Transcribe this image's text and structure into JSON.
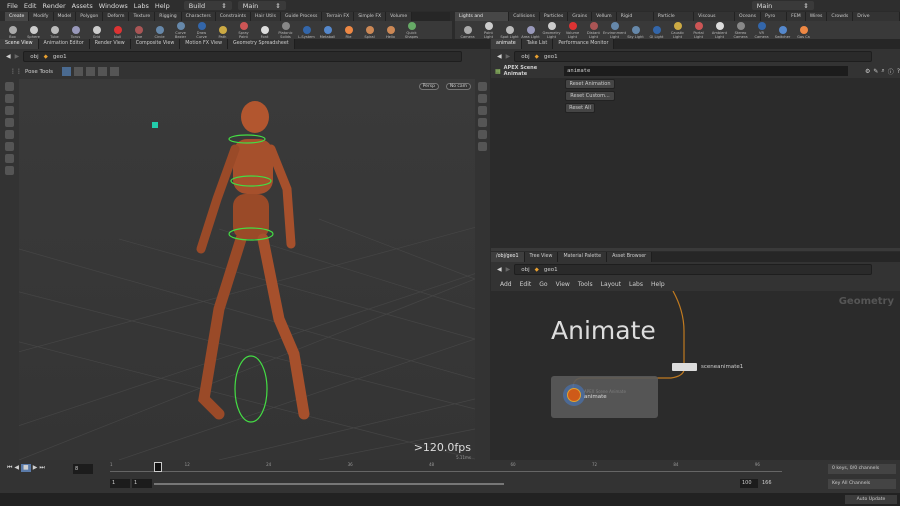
{
  "menu": [
    "File",
    "Edit",
    "Render",
    "Assets",
    "Windows",
    "Labs",
    "Help"
  ],
  "desktop": "Build",
  "desktop2": "Main",
  "desktop3": "Main",
  "shelf_left_tabs": [
    "Create",
    "Modify",
    "Model",
    "Polygon",
    "Deform",
    "Texture",
    "Rigging",
    "Characters",
    "Constraints",
    "Hair Utils",
    "Guide Process",
    "Terrain FX",
    "Simple FX",
    "Volume"
  ],
  "shelf_left_tools": [
    "Box",
    "Sphere",
    "Tube",
    "Torus",
    "Grid",
    "Null",
    "Line",
    "Circle",
    "Curve Bezier",
    "Draw Curve",
    "Path",
    "Spray Paint",
    "Font",
    "Platonic Solids",
    "L-System",
    "Metaball",
    "File",
    "Spiral",
    "Helix",
    "Quick Shapes"
  ],
  "shelf_right_tabs": [
    "Lights and Cameras",
    "Collisions",
    "Particles",
    "Grains",
    "Vellum",
    "Rigid Bodies",
    "Particle Fluids",
    "Viscous Fluids",
    "Oceans",
    "Pyro FX",
    "FEM",
    "Wires",
    "Crowds",
    "Drive Simulation"
  ],
  "shelf_right_tools": [
    "Camera",
    "Point Light",
    "Spot Light",
    "Area Light",
    "Geometry Light",
    "Volume Light",
    "Distant Light",
    "Environment Light",
    "Sky Light",
    "GI Light",
    "Caustic Light",
    "Portal Light",
    "Ambient Light",
    "Stereo Camera",
    "VR Camera",
    "Switcher",
    "Gas Ca"
  ],
  "left_pane": {
    "tabs": [
      "Scene View",
      "Animation Editor",
      "Render View",
      "Composite View",
      "Motion FX View",
      "Geometry Spreadsheet"
    ],
    "path": [
      "obj",
      "geo1"
    ],
    "pose_tools": "Pose Tools",
    "persp": "Persp",
    "cam": "No cam",
    "fps": ">120.0fps",
    "ms": "5.11ms"
  },
  "param_pane": {
    "tabs": [
      "animate",
      "Take List",
      "Performance Monitor"
    ],
    "path": [
      "obj",
      "geo1"
    ],
    "node_type": "APEX Scene Animate",
    "node_name": "animate",
    "buttons": [
      "Reset Animation",
      "Reset Custom...",
      "Reset All"
    ]
  },
  "network_pane": {
    "tabs": [
      "/obj/geo1",
      "Tree View",
      "Material Palette",
      "Asset Browser"
    ],
    "path": [
      "obj",
      "geo1"
    ],
    "menu": [
      "Add",
      "Edit",
      "Go",
      "View",
      "Tools",
      "Layout",
      "Labs",
      "Help"
    ],
    "context": "Geometry",
    "sticky": "Animate",
    "node1": "sceneanimate1",
    "node2": "animate",
    "node2_type": "APEX Scene Animate"
  },
  "timeline": {
    "frame": "8",
    "ticks": [
      "1",
      "12",
      "24",
      "36",
      "48",
      "60",
      "72",
      "84",
      "96"
    ],
    "start": "1",
    "start2": "1",
    "end": "100",
    "end2": "166",
    "keys": "0 keys, 0/0 channels",
    "key_all": "Key All Channels",
    "update": "Auto Update",
    "current": 8,
    "max": 100
  },
  "colors": {
    "accent": "#f0a030",
    "wire": "#c07a20",
    "bg": "#2b2b2b"
  }
}
